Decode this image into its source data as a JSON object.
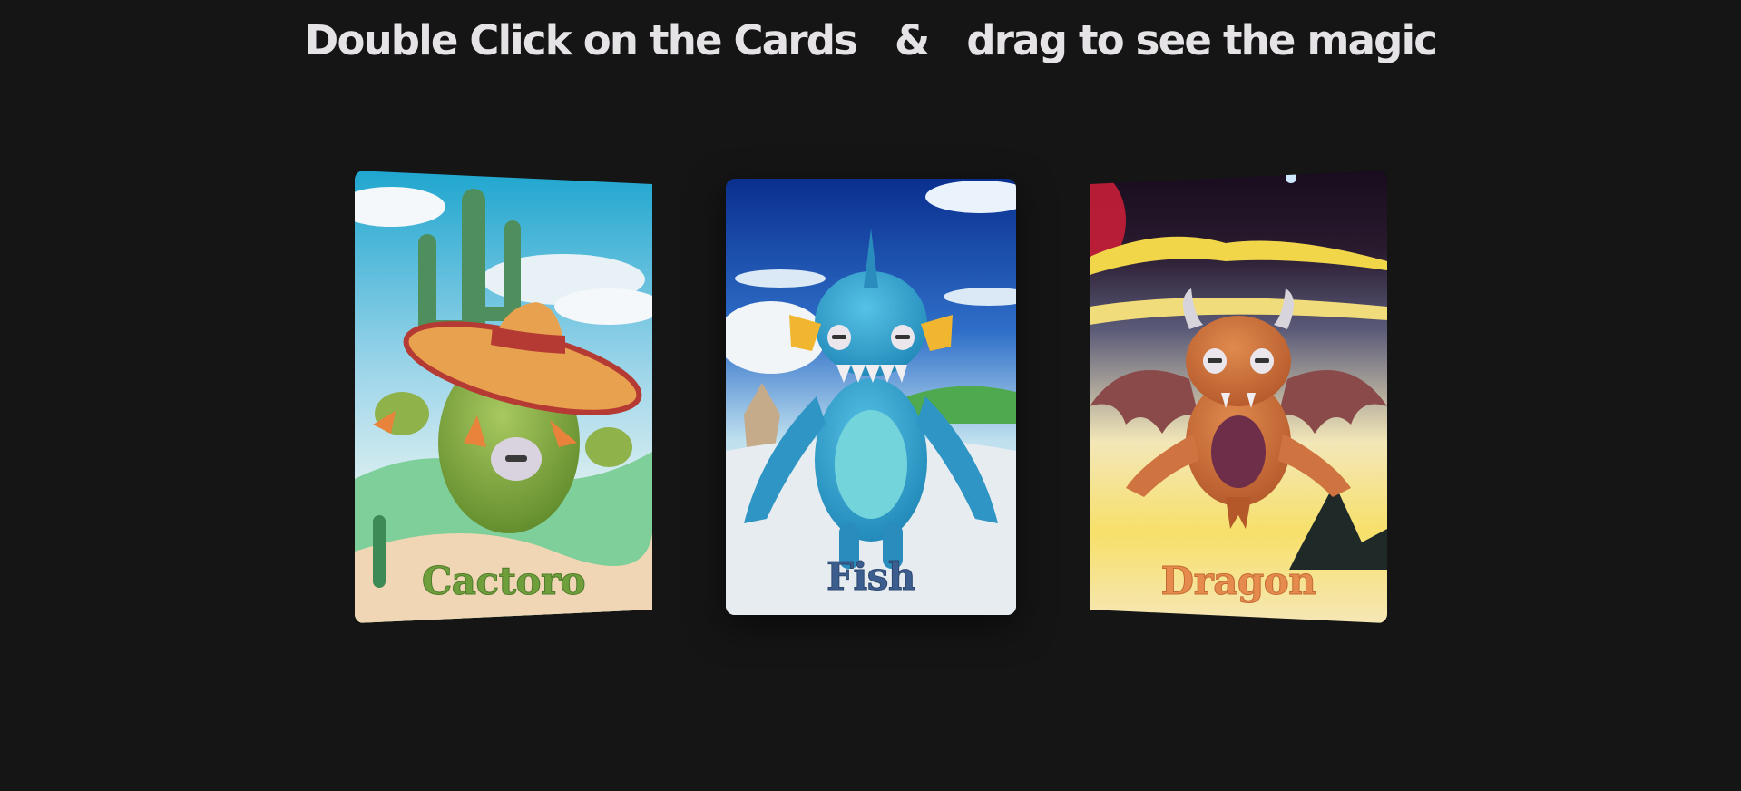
{
  "header": {
    "part1": "Double Click on the Cards",
    "amp": "&",
    "part2": "drag to see the magic"
  },
  "cards": [
    {
      "name": "Cactoro",
      "icon": "cactus-sombrero-creature",
      "name_color": "#6f9f3b"
    },
    {
      "name": "Fish",
      "icon": "blue-fish-creature",
      "name_color": "#3c5e8e"
    },
    {
      "name": "Dragon",
      "icon": "orange-dragon-creature",
      "name_color": "#e58b4e"
    }
  ],
  "colors": {
    "background": "#151515",
    "headline": "#e6e3e6"
  }
}
